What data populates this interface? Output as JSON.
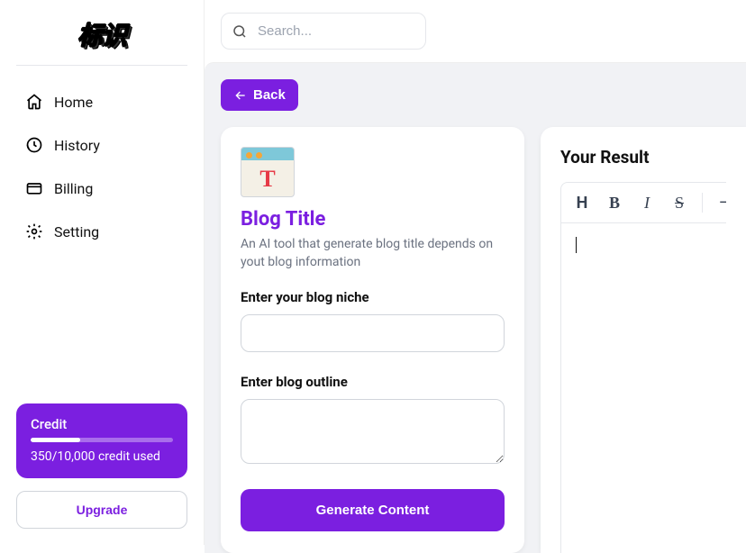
{
  "logo": {
    "text": "标识"
  },
  "nav": {
    "items": [
      {
        "label": "Home"
      },
      {
        "label": "History"
      },
      {
        "label": "Billing"
      },
      {
        "label": "Setting"
      }
    ]
  },
  "credit": {
    "title": "Credit",
    "used_label": "350/10,000 credit used",
    "progress_pct": 35
  },
  "upgrade_label": "Upgrade",
  "search": {
    "placeholder": "Search..."
  },
  "back_label": "Back",
  "template": {
    "title": "Blog Title",
    "desc": "An AI tool that generate blog title depends on yout blog information",
    "icon_letter": "T"
  },
  "form": {
    "niche_label": "Enter your blog niche",
    "niche_value": "",
    "outline_label": "Enter blog outline",
    "outline_value": "",
    "generate_label": "Generate Content"
  },
  "result": {
    "title": "Your Result",
    "content": "",
    "toolbar": {
      "heading": "H",
      "bold": "B",
      "italic": "I",
      "strike": "S",
      "hr": "―"
    }
  },
  "colors": {
    "accent": "#7b1fe0",
    "bg_muted": "#f1f2f5"
  }
}
